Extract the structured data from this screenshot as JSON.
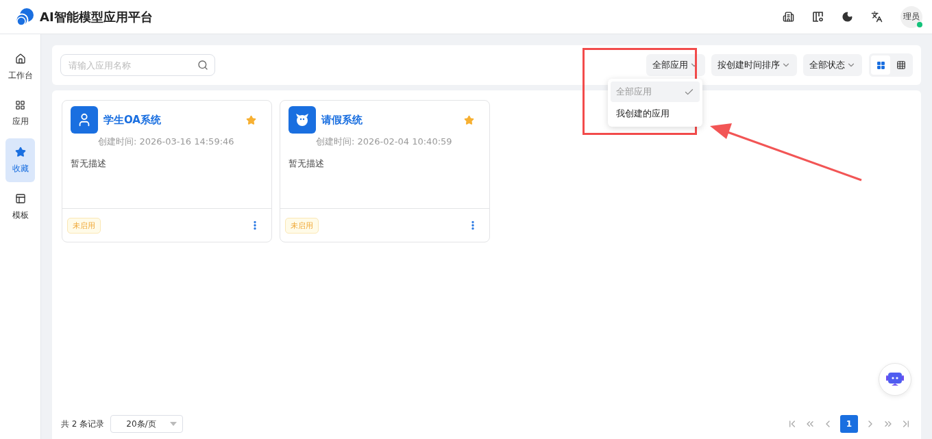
{
  "header": {
    "title": "AI智能模型应用平台",
    "actions": [
      {
        "kind": "building"
      },
      {
        "kind": "columns"
      },
      {
        "kind": "moon"
      },
      {
        "kind": "translate"
      }
    ],
    "avatar": {
      "text": "理员",
      "online": true
    }
  },
  "sidebar": {
    "items": [
      {
        "label": "工作台",
        "kind": "home",
        "selected": false
      },
      {
        "label": "应用",
        "kind": "apps",
        "selected": false
      },
      {
        "label": "收藏",
        "kind": "star",
        "selected": true
      },
      {
        "label": "模板",
        "kind": "template",
        "selected": false
      }
    ]
  },
  "toolbar": {
    "search": {
      "placeholder": "请输入应用名称"
    },
    "filters": [
      {
        "label": "全部应用",
        "options": [
          {
            "label": "全部应用",
            "selected": true
          },
          {
            "label": "我创建的应用",
            "selected": false
          }
        ]
      },
      {
        "label": "按创建时间排序"
      },
      {
        "label": "全部状态"
      }
    ],
    "view_modes": [
      {
        "kind": "cards",
        "selected": true
      },
      {
        "kind": "table",
        "selected": false
      }
    ]
  },
  "apps": [
    {
      "name": "学生OA系统",
      "kind": "user",
      "created": "创建时间: 2026-03-16 14:59:46",
      "description": "暂无描述",
      "status": "未启用",
      "favorite": true
    },
    {
      "name": "请假系统",
      "kind": "bot",
      "created": "创建时间: 2026-02-04 10:40:59",
      "description": "暂无描述",
      "status": "未启用",
      "favorite": true
    }
  ],
  "pagination": {
    "total": "共 2 条记录",
    "page_size": "20条/页",
    "pages": [
      {
        "label": "1",
        "selected": true
      }
    ]
  },
  "annotations": {
    "highlight_box": true,
    "arrow": true
  }
}
